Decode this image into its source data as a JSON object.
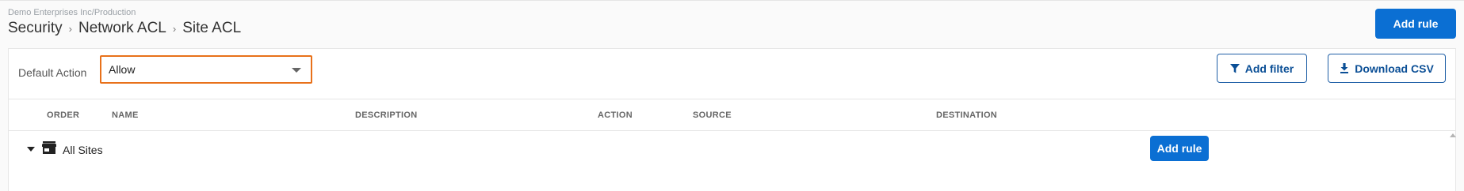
{
  "header": {
    "org_path": "Demo Enterprises Inc/Production",
    "breadcrumb": [
      "Security",
      "Network ACL",
      "Site ACL"
    ],
    "add_rule_label": "Add rule"
  },
  "toolbar": {
    "default_action_label": "Default Action",
    "default_action_value": "Allow",
    "add_filter_label": "Add filter",
    "download_csv_label": "Download CSV"
  },
  "table": {
    "columns": [
      "ORDER",
      "NAME",
      "DESCRIPTION",
      "ACTION",
      "SOURCE",
      "DESTINATION"
    ],
    "groups": [
      {
        "label": "All Sites",
        "add_rule_label": "Add rule"
      }
    ]
  },
  "colors": {
    "primary": "#0b6fd3",
    "focus_outline": "#e8711a",
    "outline_button_text": "#0b4f96"
  },
  "icons": {
    "filter": "funnel-icon",
    "download": "download-icon",
    "expand": "caret-down-icon",
    "site": "store-icon"
  }
}
